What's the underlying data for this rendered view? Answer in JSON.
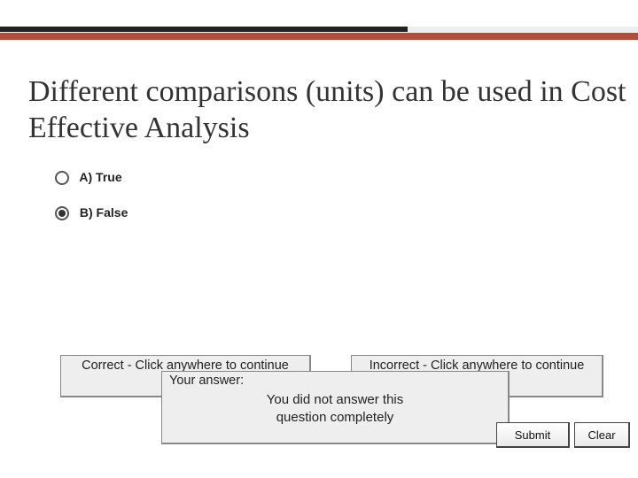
{
  "question": {
    "title": "Different comparisons (units) can be used in Cost Effective Analysis",
    "options": [
      {
        "label": "A) True",
        "selected": false
      },
      {
        "label": "B) False",
        "selected": true
      }
    ]
  },
  "feedback": {
    "correct": "Correct - Click anywhere to continue",
    "incorrect": "Incorrect - Click anywhere to continue",
    "your_answer_label": "Your answer:",
    "incomplete_line1": "You did not answer this",
    "incomplete_line2": "question completely"
  },
  "buttons": {
    "submit": "Submit",
    "clear": "Clear"
  },
  "colors": {
    "accent_red": "#b84b3a",
    "dark": "#222222",
    "panel": "#eeeeee"
  }
}
